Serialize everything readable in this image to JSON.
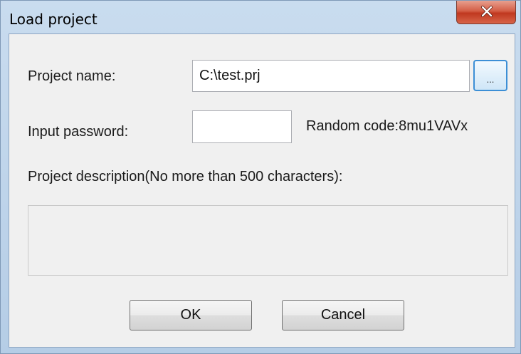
{
  "window": {
    "title": "Load project",
    "close_icon": "close-icon"
  },
  "form": {
    "project_name_label": "Project name:",
    "project_name_value": "C:\\test.prj",
    "browse_label": "...",
    "password_label": "Input password:",
    "password_value": "",
    "random_code_label": "Random code:8mu1VAVx",
    "description_label": "Project description(No more than 500 characters):",
    "description_value": ""
  },
  "buttons": {
    "ok_label": "OK",
    "cancel_label": "Cancel"
  },
  "colors": {
    "title_bar": "#c9dcef",
    "close_button": "#c84a32",
    "dialog_background": "#f0f0f0",
    "focus_border": "#3c8fd6"
  }
}
